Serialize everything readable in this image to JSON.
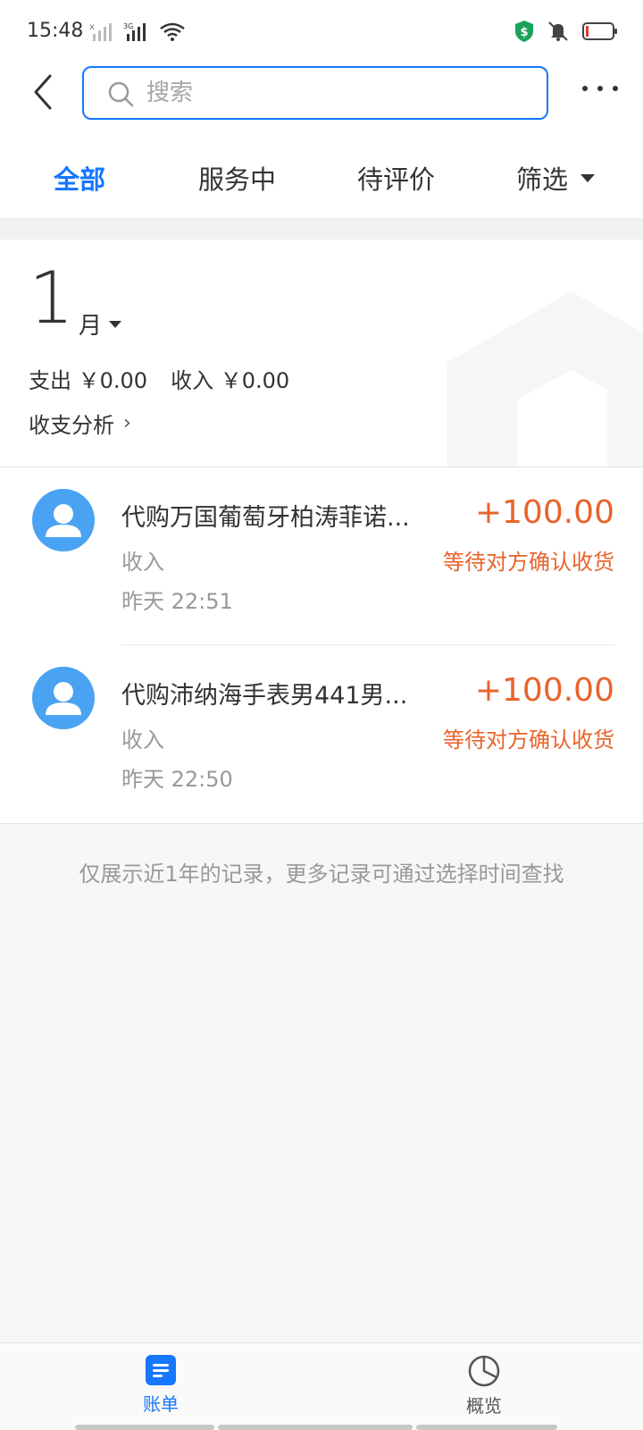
{
  "status_bar": {
    "time": "15:48"
  },
  "search": {
    "placeholder": "搜索"
  },
  "tabs": [
    {
      "label": "全部",
      "active": true
    },
    {
      "label": "服务中",
      "active": false
    },
    {
      "label": "待评价",
      "active": false
    },
    {
      "label": "筛选",
      "active": false
    }
  ],
  "summary": {
    "month": "1",
    "month_unit": "月",
    "expense_label": "支出",
    "expense_value": "￥0.00",
    "income_label": "收入",
    "income_value": "￥0.00",
    "analysis_link": "收支分析"
  },
  "transactions": [
    {
      "title": "代购万国葡萄牙柏涛菲诺...",
      "amount": "+100.00",
      "type": "收入",
      "status": "等待对方确认收货",
      "time": "昨天  22:51"
    },
    {
      "title": "代购沛纳海手表男441男...",
      "amount": "+100.00",
      "type": "收入",
      "status": "等待对方确认收货",
      "time": "昨天  22:50"
    }
  ],
  "footer_note": "仅展示近1年的记录，更多记录可通过选择时间查找",
  "bottom_nav": [
    {
      "label": "账单",
      "active": true,
      "icon": "bill-icon"
    },
    {
      "label": "概览",
      "active": false,
      "icon": "pie-chart-icon"
    }
  ],
  "colors": {
    "accent": "#1677ff",
    "amount": "#e8642b",
    "avatar": "#4aa3f2"
  }
}
